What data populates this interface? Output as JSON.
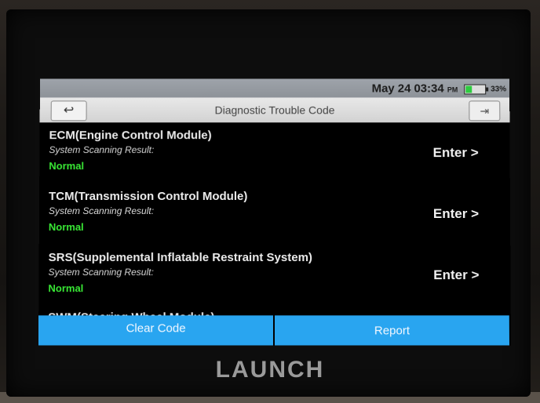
{
  "status_bar": {
    "date": "May 24",
    "time": "03:34",
    "ampm": "PM",
    "battery": "33%",
    "battery_level": 0.33
  },
  "header": {
    "title": "Diagnostic Trouble Code"
  },
  "modules": [
    {
      "name": "ECM(Engine Control Module)",
      "result_label": "System Scanning Result:",
      "result": "Normal",
      "action": "Enter >"
    },
    {
      "name": "TCM(Transmission Control Module)",
      "result_label": "System Scanning Result:",
      "result": "Normal",
      "action": "Enter >"
    },
    {
      "name": "SRS(Supplemental Inflatable Restraint System)",
      "result_label": "System Scanning Result:",
      "result": "Normal",
      "action": "Enter >"
    }
  ],
  "partial_item": "SWM(Steering Wheel Module)",
  "buttons": {
    "clear": "Clear Code",
    "report": "Report"
  },
  "brand": "LAUNCH",
  "icons": {
    "back": "back-arrow-icon",
    "exit": "exit-icon"
  },
  "colors": {
    "accent": "#29a5f0",
    "status_normal": "#39e835"
  }
}
